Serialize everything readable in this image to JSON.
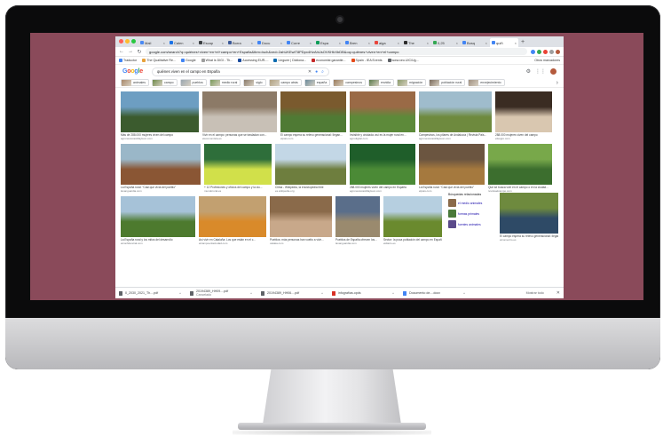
{
  "browser": {
    "tabs": [
      {
        "label": "Mail",
        "color": "#4a8af4"
      },
      {
        "label": "Calen",
        "color": "#1a73e8"
      },
      {
        "label": "Escap",
        "color": "#3c4043"
      },
      {
        "label": "Borra",
        "color": "#3b5998"
      },
      {
        "label": "Docu",
        "color": "#4285f4"
      },
      {
        "label": "Corre",
        "color": "#4285f4"
      },
      {
        "label": "Espa",
        "color": "#0f9d58"
      },
      {
        "label": "Bren",
        "color": "#4285f4"
      },
      {
        "label": "aiga",
        "color": "#e8453c"
      },
      {
        "label": "The",
        "color": "#2c2c2c"
      },
      {
        "label": "0,25",
        "color": "#34a853"
      },
      {
        "label": "Bosq",
        "color": "#4285f4"
      },
      {
        "label": "quiñ",
        "color": "#4285f4",
        "active": true
      }
    ],
    "new_tab": "+",
    "url": "google.com/search?q=quiénes+viven+en+el+campo+en+España&tbm=isch&ved=2ahUKEwiT8PDpx4HzAhUsOVKHbXbDB&oq=quiénes+viven+en+el+campo",
    "bookmarks": [
      {
        "label": "Traductor",
        "color": "#4285f4"
      },
      {
        "label": "The Qualitative Re...",
        "color": "#e8a23c"
      },
      {
        "label": "Google",
        "color": "#4285f4"
      },
      {
        "label": "What is DIGI - Th...",
        "color": "#9e9e9e"
      },
      {
        "label": "Accessing EUR-...",
        "color": "#1a4b9e"
      },
      {
        "label": "Linguee | Dictiona...",
        "color": "#0a6bb0"
      },
      {
        "label": "economist garantie...",
        "color": "#c62828"
      },
      {
        "label": "Spain - IEA Events",
        "color": "#e64a19"
      },
      {
        "label": "www.ceo.UIC/Ug...",
        "color": "#5f6368"
      }
    ],
    "other_bookmarks": "Otros marcadores"
  },
  "google": {
    "logo": "Google",
    "query": "quiénes viven en el campo en España",
    "chips": [
      "animales",
      "campo",
      "pueblos",
      "medio rural",
      "siglo",
      "campo atrás",
      "españa",
      "campesinos",
      "envidia",
      "migración",
      "población rural",
      "envejecimiento"
    ],
    "results_row1": [
      {
        "caption": "Más de 288.000 mujeres viven del campo",
        "source": "agronewscastillayleon.com",
        "w": 88,
        "c1": "#6d9ec2",
        "c2": "#3b5b2e"
      },
      {
        "caption": "Vivir en el campo: personas que se trasladan con...",
        "source": "eleconomista.es",
        "w": 84,
        "c1": "#8c7a67",
        "c2": "#c8c0b6"
      },
      {
        "caption": "El campo espera su relevo generacional: llegan...",
        "source": "elpais.com",
        "w": 74,
        "c1": "#7a5a2e",
        "c2": "#4f7a34"
      },
      {
        "caption": "Invisible y olvidada: así es la mujer rural en...",
        "source": "agrodigital.com",
        "w": 74,
        "c1": "#9a6a46",
        "c2": "#5d8a3a"
      },
      {
        "caption": "Campesinos, los pilares de Andalucía | Revista Pais...",
        "source": "agronewscastillayleon.com",
        "w": 82,
        "c1": "#9fbccc",
        "c2": "#6e8a3e"
      },
      {
        "caption": "288.000 mujeres viven del campo",
        "source": "efeagro.com",
        "w": 64,
        "c1": "#3a2c22",
        "c2": "#d9c7b0"
      }
    ],
    "results_row2": [
      {
        "caption": "La España rural: \"Casi que vivía del pueblo\"",
        "source": "lavanguardia.com",
        "w": 90,
        "c1": "#9ab7c8",
        "c2": "#8a5634"
      },
      {
        "caption": "+ 12 Profesiones y oficios del campo y la ciu...",
        "source": "mundorural.es",
        "w": 76,
        "c1": "#2e6e3a",
        "c2": "#d1e04a"
      },
      {
        "caption": "Clima - Wikipedia, la enciclopedia libre",
        "source": "es.wikipedia.org",
        "w": 80,
        "c1": "#c3d7e6",
        "c2": "#6e7e3e"
      },
      {
        "caption": "288.000 mujeres viven del campo en España",
        "source": "agronewscastillayleon.com",
        "w": 74,
        "c1": "#1f5e2a",
        "c2": "#4b8a36"
      },
      {
        "caption": "La España rural: \"Casi que vivía del pueblo\"",
        "source": "elpais.com",
        "w": 74,
        "c1": "#6b5540",
        "c2": "#a5793e"
      },
      {
        "caption": "Que se busca vivir en el campo o en la ciudad...",
        "source": "revistaelcampo.com",
        "w": 72,
        "c1": "#78a84a",
        "c2": "#3c6e2e"
      }
    ],
    "results_row3": [
      {
        "caption": "La España rural y los mitos del desarrollo",
        "source": "elconfidencial.com",
        "w": 84,
        "c1": "#a6c2d8",
        "c2": "#4d7a2e"
      },
      {
        "caption": "Así vivir en Cataluña: Los que están en el c...",
        "source": "elcampoenlaciudad.com",
        "w": 76,
        "c1": "#c2a070",
        "c2": "#d98a2a"
      },
      {
        "caption": "Pueblos: más personas han vuelto a vivir...",
        "source": "xataka.com",
        "w": 70,
        "c1": "#8a6a4a",
        "c2": "#c8a88a"
      },
      {
        "caption": "Pueblos de España ofrecen los...",
        "source": "lavanguardia.com",
        "w": 50,
        "c1": "#5a6e8a",
        "c2": "#9a8a6e"
      },
      {
        "caption": "Sector: la poca población del campo en España",
        "source": "eldiario.es",
        "w": 66,
        "c1": "#b6cfe0",
        "c2": "#6a8a2e"
      }
    ],
    "results_row3_last": {
      "caption": "El campo espera su relevo generacional: llegan...",
      "source": "elcomercio.es",
      "w": 66,
      "c1": "#6e8a3e",
      "c2": "#2e4a66"
    },
    "related": {
      "title": "Búsquedas relacionadas",
      "items": [
        {
          "label": "el medio animales",
          "color": "#8a6a4a"
        },
        {
          "label": "formas primales",
          "color": "#4a7a3a"
        },
        {
          "label": "fuentes animales",
          "color": "#5a4a8a"
        }
      ]
    },
    "downloads": [
      {
        "name": "0_2030_2021_Th....pdf",
        "color": "#5f6368"
      },
      {
        "name": "20194389_HH09....pdf",
        "sub": "Cancelado",
        "color": "#5f6368"
      },
      {
        "name": "20194389_HH06....pdf",
        "color": "#5f6368"
      },
      {
        "name": "infografías.opds",
        "color": "#d93025"
      },
      {
        "name": "Documento de....docx",
        "color": "#4285f4"
      }
    ],
    "show_all": "Mostrar todo"
  }
}
